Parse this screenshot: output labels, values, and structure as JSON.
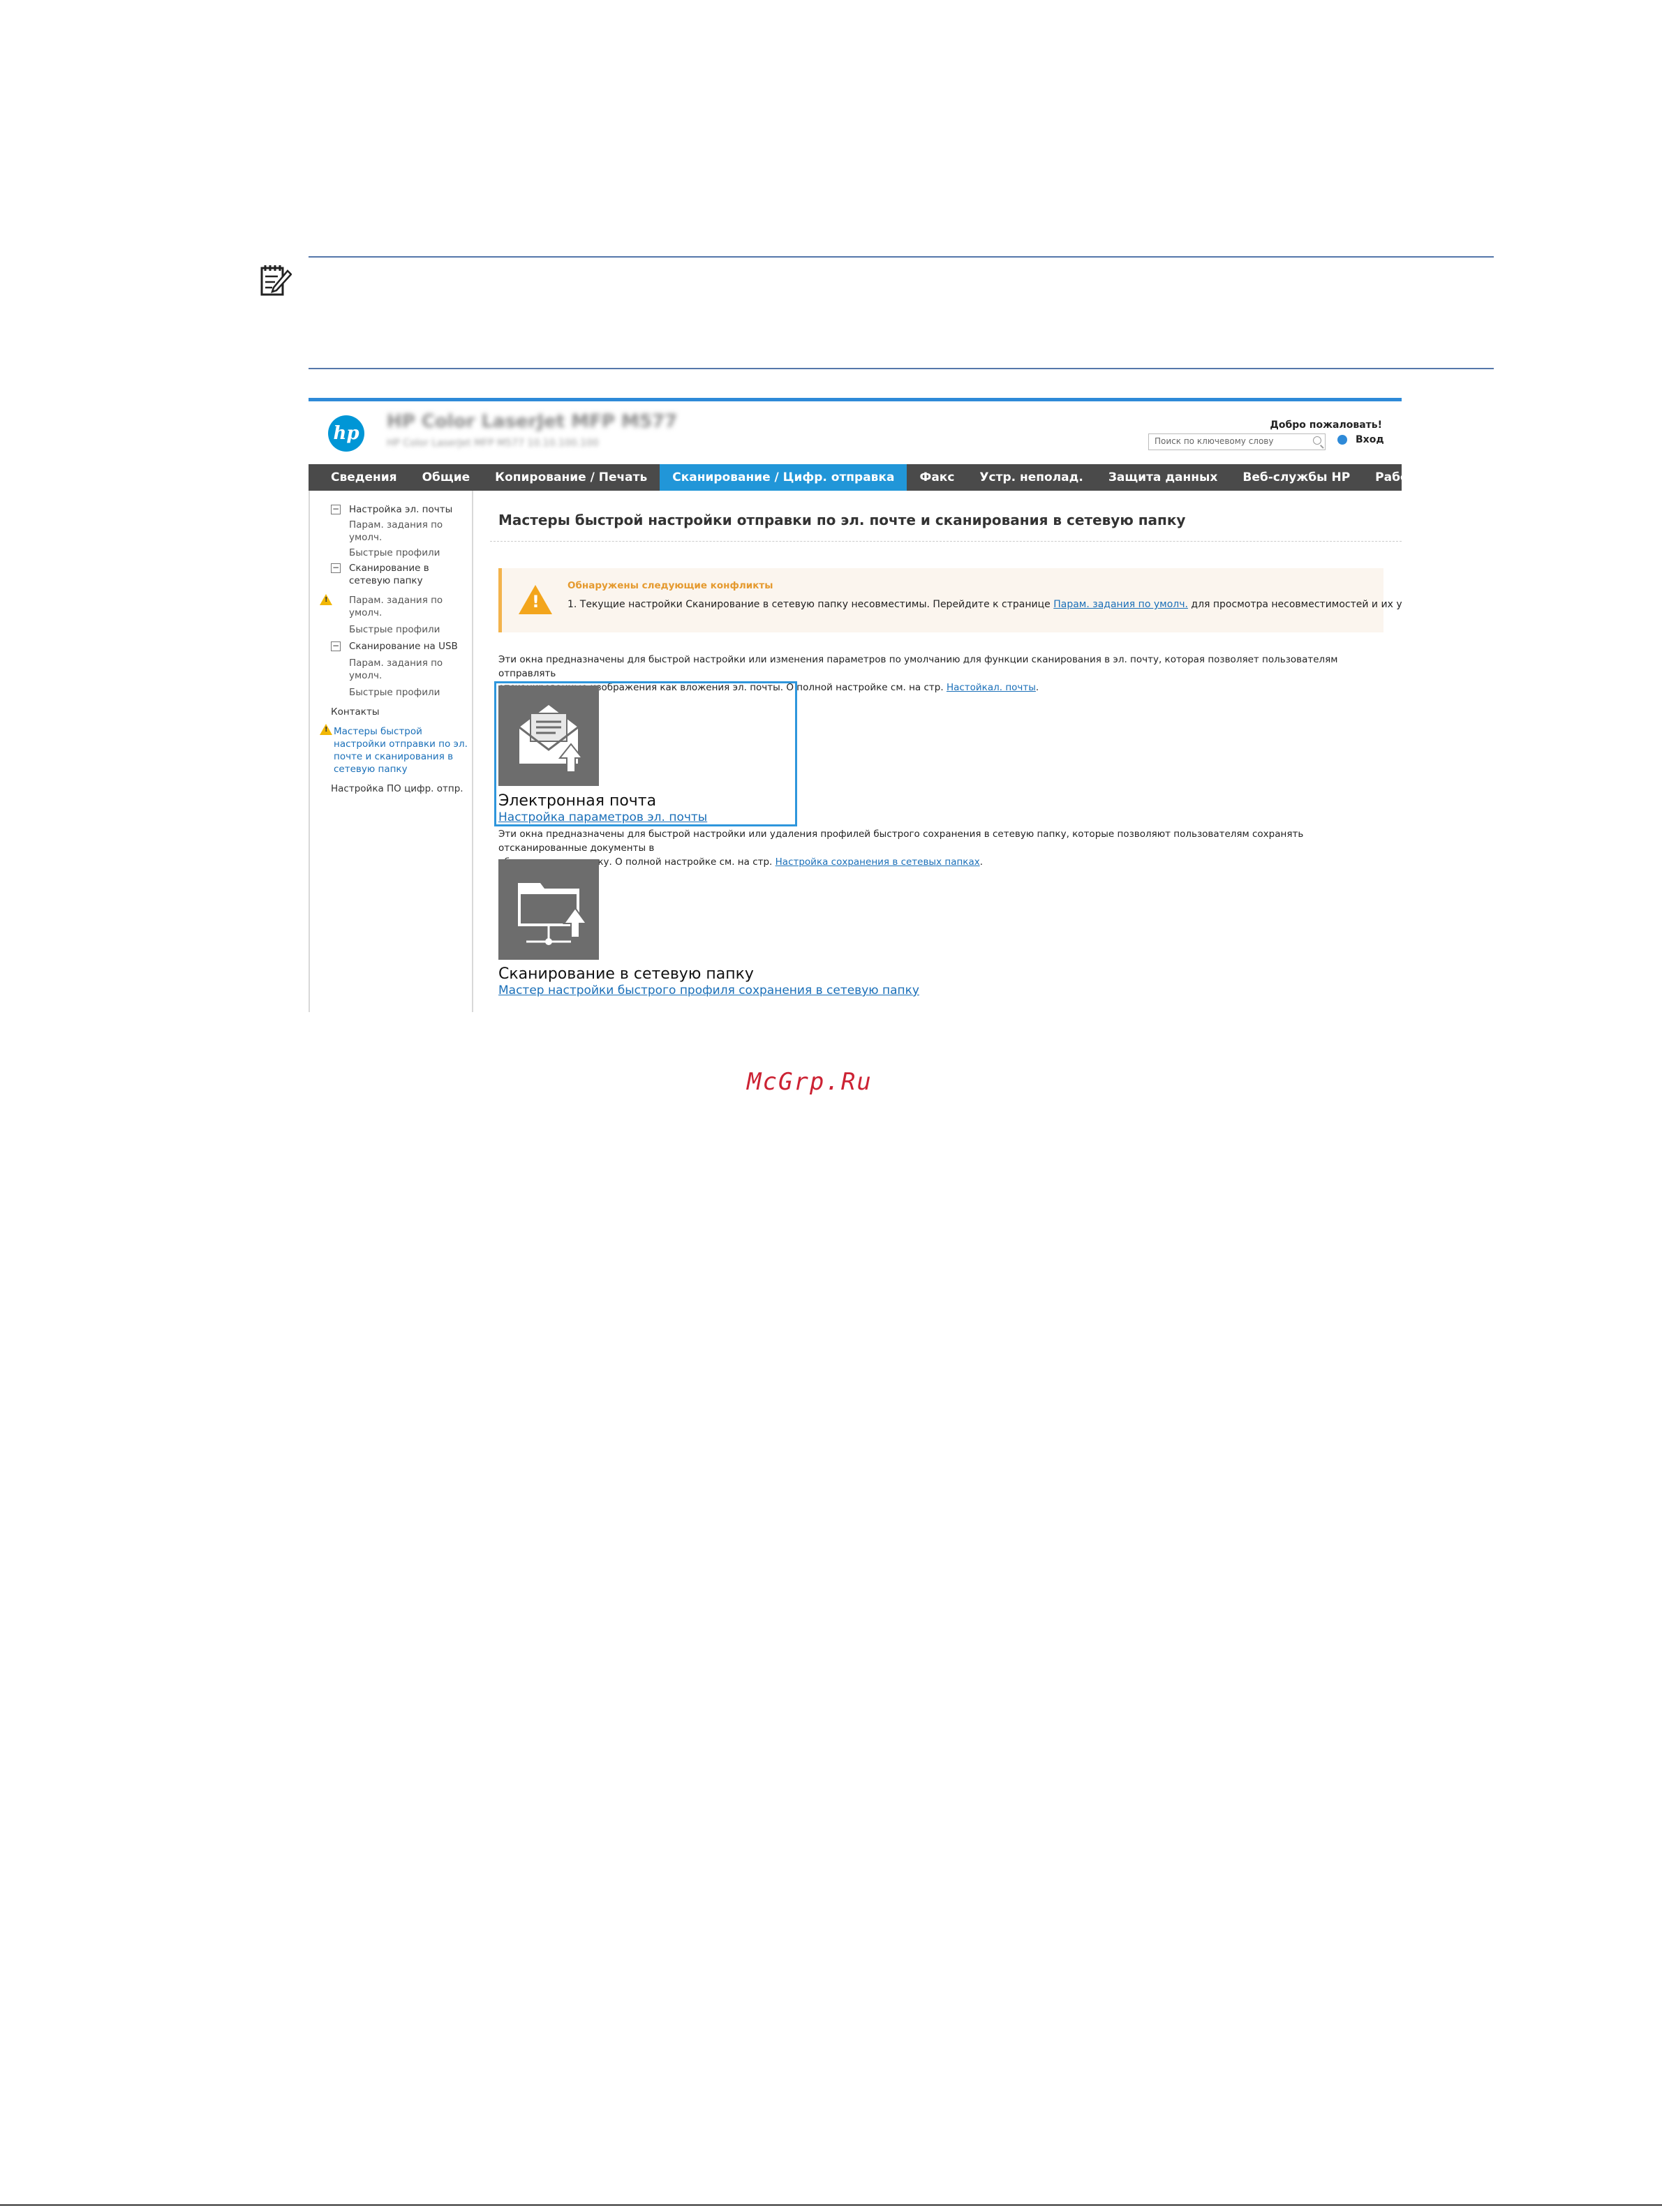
{
  "header": {
    "product_title": "HP Color LaserJet MFP M577",
    "product_subtitle": "HP Color LaserJet MFP M577   10.10.100.100",
    "welcome": "Добро пожаловать!",
    "search_placeholder": "Поиск по ключевому слову",
    "signin": "Вход",
    "logo": "hp"
  },
  "nav": {
    "tabs": [
      {
        "label": "Сведения"
      },
      {
        "label": "Общие"
      },
      {
        "label": "Копирование / Печать"
      },
      {
        "label": "Сканирование / Цифр. отправка",
        "active": true
      },
      {
        "label": "Факс"
      },
      {
        "label": "Устр. неполад."
      },
      {
        "label": "Защита данных"
      },
      {
        "label": "Веб-службы HP"
      },
      {
        "label": "Работа в сети"
      }
    ]
  },
  "sidebar": {
    "email_setup": "Настройка эл. почты",
    "email_defaults_1": "Парам. задания по",
    "email_defaults_2": "умолч.",
    "email_quick": "Быстрые профили",
    "folder_scan_1": "Сканирование в",
    "folder_scan_2": "сетевую папку",
    "folder_defaults_1": "Парам. задания по",
    "folder_defaults_2": "умолч.",
    "folder_quick": "Быстрые профили",
    "usb_scan": "Сканирование на USB",
    "usb_defaults_1": "Парам. задания по",
    "usb_defaults_2": "умолч.",
    "usb_quick": "Быстрые профили",
    "contacts": "Контакты",
    "wizard_1": "Мастеры быстрой",
    "wizard_2": "настройки отправки по эл.",
    "wizard_3": "почте и сканирования в",
    "wizard_4": "сетевую папку",
    "digital_send": "Настройка ПО цифр. отпр."
  },
  "main": {
    "title": "Мастеры быстрой настройки отправки по эл. почте и сканирования в сетевую папку",
    "alert": {
      "heading": "Обнаружены следующие конфликты",
      "item_prefix": "1.  Текущие настройки Сканирование в сетевую папку несовместимы. Перейдите к странице ",
      "item_link": "Парам. задания по умолч.",
      "item_suffix": " для просмотра несовместимостей и их устранения."
    },
    "email_intro_1": "Эти окна предназначены для быстрой настройки или изменения параметров по умолчанию для функции сканирования в эл. почту, которая позволяет пользователям отправлять",
    "email_intro_2": "отсканированные изображения как вложения эл. почты. О полной настройке см. на стр. ",
    "email_intro_link": "Настойкал. почты",
    "email_tile_title": "Электронная почта",
    "email_tile_link": "Настройка параметров эл. почты",
    "folder_intro_1": "Эти окна предназначены для быстрой настройки или удаления профилей быстрого сохранения в сетевую папку, которые позволяют пользователям сохранять отсканированные документы в",
    "folder_intro_2": "общую сетевую папку. О полной настройке см. на стр. ",
    "folder_intro_link": "Настройка сохранения в сетевых папках",
    "folder_tile_title": "Сканирование в сетевую папку",
    "folder_tile_link": "Мастер настройки быстрого профиля сохранения в сетевую папку"
  },
  "watermark": "McGrp.Ru",
  "colors": {
    "accent_blue": "#2196d8",
    "nav_bg": "#4a4a4a",
    "warning": "#f3a51c",
    "link": "#1a6fb8"
  }
}
